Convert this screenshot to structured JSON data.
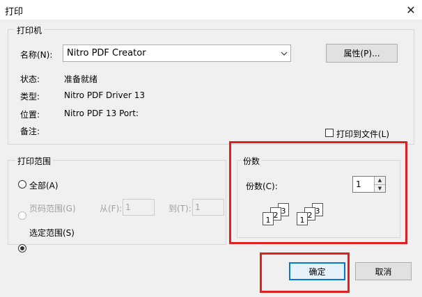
{
  "window": {
    "title": "打印",
    "close_glyph": "✕"
  },
  "printer": {
    "group_title": "打印机",
    "name_label": "名称(N):",
    "name_value": "Nitro PDF Creator",
    "properties_button": "属性(P)...",
    "status_label": "状态:",
    "status_value": "准备就绪",
    "type_label": "类型:",
    "type_value": "Nitro PDF Driver 13",
    "where_label": "位置:",
    "where_value": "Nitro PDF 13 Port:",
    "comment_label": "备注:",
    "print_to_file_label": "打印到文件(L)",
    "print_to_file_checked": false
  },
  "range": {
    "group_title": "打印范围",
    "all_label": "全部(A)",
    "pages_label": "页码范围(G)",
    "from_label": "从(F):",
    "from_value": "1",
    "to_label": "到(T):",
    "to_value": "1",
    "selection_label": "选定范围(S)",
    "selected_option": "selection"
  },
  "copies": {
    "group_title": "份数",
    "count_label": "份数(C):",
    "count_value": "1",
    "collate_pages": [
      "1",
      "2",
      "3"
    ]
  },
  "buttons": {
    "ok": "确定",
    "cancel": "取消"
  },
  "colors": {
    "highlight": "#e0201e",
    "accent": "#0078d7"
  }
}
